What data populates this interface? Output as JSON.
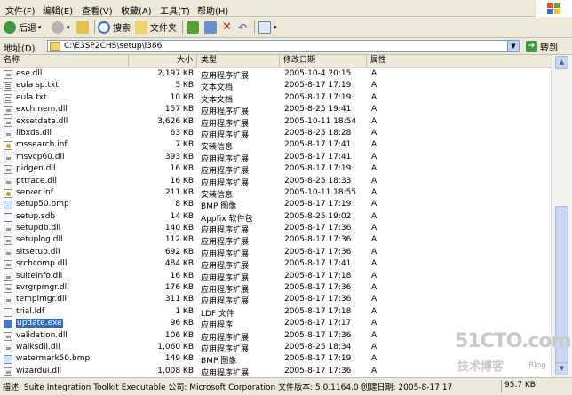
{
  "menu": [
    "文件(F)",
    "编辑(E)",
    "查看(V)",
    "收藏(A)",
    "工具(T)",
    "帮助(H)"
  ],
  "toolbar": {
    "back_label": "后退",
    "search_label": "搜索",
    "folders_label": "文件夹"
  },
  "address": {
    "label": "地址(D)",
    "path": "C:\\E3SP2CHS\\setup\\i386",
    "go_label": "转到"
  },
  "columns": {
    "name": "名称",
    "size": "大小",
    "type": "类型",
    "modified": "修改日期",
    "attributes": "属性"
  },
  "files": [
    {
      "name": "ese.dll",
      "size": "2,197 KB",
      "type": "应用程序扩展",
      "modified": "2005-10-4 20:15",
      "attr": "A",
      "icon": "dll"
    },
    {
      "name": "eula sp.txt",
      "size": "5 KB",
      "type": "文本文档",
      "modified": "2005-8-17 17:19",
      "attr": "A",
      "icon": "txt"
    },
    {
      "name": "eula.txt",
      "size": "10 KB",
      "type": "文本文档",
      "modified": "2005-8-17 17:19",
      "attr": "A",
      "icon": "txt"
    },
    {
      "name": "exchmem.dll",
      "size": "157 KB",
      "type": "应用程序扩展",
      "modified": "2005-8-25 19:41",
      "attr": "A",
      "icon": "dll"
    },
    {
      "name": "exsetdata.dll",
      "size": "3,626 KB",
      "type": "应用程序扩展",
      "modified": "2005-10-11 18:54",
      "attr": "A",
      "icon": "dll"
    },
    {
      "name": "libxds.dll",
      "size": "63 KB",
      "type": "应用程序扩展",
      "modified": "2005-8-25 18:28",
      "attr": "A",
      "icon": "dll"
    },
    {
      "name": "mssearch.inf",
      "size": "7 KB",
      "type": "安装信息",
      "modified": "2005-8-17 17:41",
      "attr": "A",
      "icon": "inf"
    },
    {
      "name": "msvcp60.dll",
      "size": "393 KB",
      "type": "应用程序扩展",
      "modified": "2005-8-17 17:41",
      "attr": "A",
      "icon": "dll"
    },
    {
      "name": "pidgen.dll",
      "size": "16 KB",
      "type": "应用程序扩展",
      "modified": "2005-8-17 17:19",
      "attr": "A",
      "icon": "dll"
    },
    {
      "name": "pttrace.dll",
      "size": "16 KB",
      "type": "应用程序扩展",
      "modified": "2005-8-25 18:33",
      "attr": "A",
      "icon": "dll"
    },
    {
      "name": "server.inf",
      "size": "211 KB",
      "type": "安装信息",
      "modified": "2005-10-11 18:55",
      "attr": "A",
      "icon": "inf"
    },
    {
      "name": "setup50.bmp",
      "size": "8 KB",
      "type": "BMP 图像",
      "modified": "2005-8-17 17:19",
      "attr": "A",
      "icon": "bmp"
    },
    {
      "name": "setup.sdb",
      "size": "14 KB",
      "type": "Appfix 软件包",
      "modified": "2005-8-25 19:02",
      "attr": "A",
      "icon": "sdb"
    },
    {
      "name": "setupdb.dll",
      "size": "140 KB",
      "type": "应用程序扩展",
      "modified": "2005-8-17 17:36",
      "attr": "A",
      "icon": "dll"
    },
    {
      "name": "setuplog.dll",
      "size": "112 KB",
      "type": "应用程序扩展",
      "modified": "2005-8-17 17:36",
      "attr": "A",
      "icon": "dll"
    },
    {
      "name": "sitsetup.dll",
      "size": "692 KB",
      "type": "应用程序扩展",
      "modified": "2005-8-17 17:36",
      "attr": "A",
      "icon": "dll"
    },
    {
      "name": "srchcomp.dll",
      "size": "484 KB",
      "type": "应用程序扩展",
      "modified": "2005-8-17 17:41",
      "attr": "A",
      "icon": "dll"
    },
    {
      "name": "suiteinfo.dll",
      "size": "16 KB",
      "type": "应用程序扩展",
      "modified": "2005-8-17 17:18",
      "attr": "A",
      "icon": "dll"
    },
    {
      "name": "svrgrpmgr.dll",
      "size": "176 KB",
      "type": "应用程序扩展",
      "modified": "2005-8-17 17:36",
      "attr": "A",
      "icon": "dll"
    },
    {
      "name": "templmgr.dll",
      "size": "311 KB",
      "type": "应用程序扩展",
      "modified": "2005-8-17 17:36",
      "attr": "A",
      "icon": "dll"
    },
    {
      "name": "trial.ldf",
      "size": "1 KB",
      "type": "LDF 文件",
      "modified": "2005-8-17 17:18",
      "attr": "A",
      "icon": "ldf"
    },
    {
      "name": "update.exe",
      "size": "96 KB",
      "type": "应用程序",
      "modified": "2005-8-17 17:17",
      "attr": "A",
      "icon": "exe",
      "selected": true
    },
    {
      "name": "validation.dll",
      "size": "106 KB",
      "type": "应用程序扩展",
      "modified": "2005-8-17 17:36",
      "attr": "A",
      "icon": "dll"
    },
    {
      "name": "walksdll.dll",
      "size": "1,060 KB",
      "type": "应用程序扩展",
      "modified": "2005-8-25 18:34",
      "attr": "A",
      "icon": "dll"
    },
    {
      "name": "watermark50.bmp",
      "size": "149 KB",
      "type": "BMP 图像",
      "modified": "2005-8-17 17:19",
      "attr": "A",
      "icon": "bmp"
    },
    {
      "name": "wizardui.dll",
      "size": "1,008 KB",
      "type": "应用程序扩展",
      "modified": "2005-8-17 17:36",
      "attr": "A",
      "icon": "dll"
    }
  ],
  "status": {
    "description": "描述: Suite Integration Toolkit Executable 公司: Microsoft Corporation 文件版本: 5.0.1164.0 创建日期: 2005-8-17 17",
    "size": "95.7 KB"
  },
  "watermark": {
    "main": "51CTO.com",
    "sub": "技术博客",
    "blog": "Blog"
  },
  "colors": {
    "selection": "#316ac5",
    "chrome": "#ece9d8"
  }
}
